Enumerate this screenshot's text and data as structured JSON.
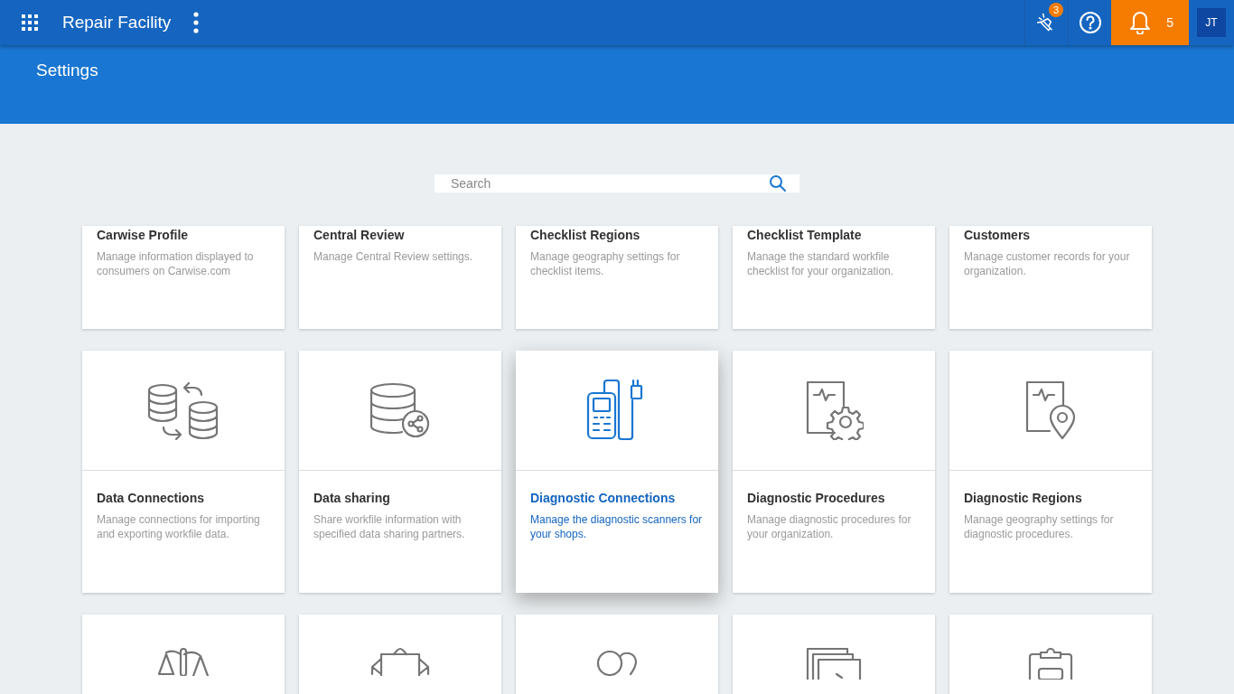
{
  "app_bar": {
    "title": "Repair Facility",
    "announcements_badge": "3",
    "notifications_count": "5",
    "avatar": "JT"
  },
  "page_title": "Settings",
  "search": {
    "placeholder": "Search"
  },
  "rows": [
    {
      "kind": "text",
      "cards": [
        {
          "title": "Carwise Profile",
          "description": "Manage information displayed to consumers on Carwise.com",
          "selected": false
        },
        {
          "title": "Central Review",
          "description": "Manage Central Review settings.",
          "selected": false
        },
        {
          "title": "Checklist Regions",
          "description": "Manage geography settings for checklist items.",
          "selected": false
        },
        {
          "title": "Checklist Template",
          "description": "Manage the standard workfile checklist for your organization.",
          "selected": false
        },
        {
          "title": "Customers",
          "description": "Manage customer records for your organization.",
          "selected": false
        }
      ]
    },
    {
      "kind": "full",
      "cards": [
        {
          "title": "Data Connections",
          "description": "Manage connections for importing and exporting workfile data.",
          "selected": false
        },
        {
          "title": "Data sharing",
          "description": "Share workfile information with specified data sharing partners.",
          "selected": false
        },
        {
          "title": "Diagnostic Connections",
          "description": "Manage the diagnostic scanners for your shops.",
          "selected": true
        },
        {
          "title": "Diagnostic Procedures",
          "description": "Manage diagnostic procedures for your organization.",
          "selected": false
        },
        {
          "title": "Diagnostic Regions",
          "description": "Manage geography settings for diagnostic procedures.",
          "selected": false
        }
      ]
    },
    {
      "kind": "icon",
      "cards": [
        {
          "selected": false
        },
        {
          "selected": false
        },
        {
          "selected": false
        },
        {
          "selected": false
        },
        {
          "selected": false
        }
      ]
    }
  ]
}
